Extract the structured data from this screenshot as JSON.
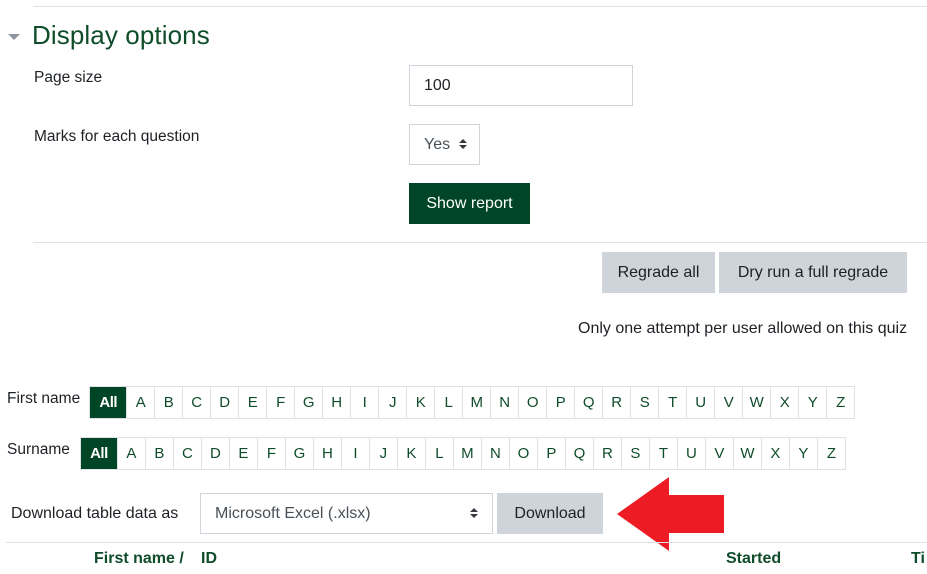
{
  "display_options": {
    "section_title": "Display options",
    "page_size_label": "Page size",
    "page_size_value": "100",
    "marks_label": "Marks for each question",
    "marks_value": "Yes",
    "show_report_label": "Show report"
  },
  "regrade": {
    "regrade_all_label": "Regrade all",
    "dry_run_label": "Dry run a full regrade",
    "notice": "Only one attempt per user allowed on this quiz"
  },
  "initials_bars": {
    "first_name": {
      "label": "First name",
      "all_label": "All",
      "letters": [
        "A",
        "B",
        "C",
        "D",
        "E",
        "F",
        "G",
        "H",
        "I",
        "J",
        "K",
        "L",
        "M",
        "N",
        "O",
        "P",
        "Q",
        "R",
        "S",
        "T",
        "U",
        "V",
        "W",
        "X",
        "Y",
        "Z"
      ]
    },
    "surname": {
      "label": "Surname",
      "all_label": "All",
      "letters": [
        "A",
        "B",
        "C",
        "D",
        "E",
        "F",
        "G",
        "H",
        "I",
        "J",
        "K",
        "L",
        "M",
        "N",
        "O",
        "P",
        "Q",
        "R",
        "S",
        "T",
        "U",
        "V",
        "W",
        "X",
        "Y",
        "Z"
      ]
    }
  },
  "download": {
    "label": "Download table data as",
    "format_value": "Microsoft Excel (.xlsx)",
    "button_label": "Download"
  },
  "annotation": {
    "arrow_color": "#ed1c24",
    "arrow_direction": "left"
  },
  "table_headers": {
    "first_name": "First name /",
    "id": "ID",
    "started": "Started",
    "time": "Ti"
  },
  "colors": {
    "brand_dark_green": "#004526",
    "heading_green": "#0f4c2a",
    "secondary_button": "#ced4da"
  }
}
